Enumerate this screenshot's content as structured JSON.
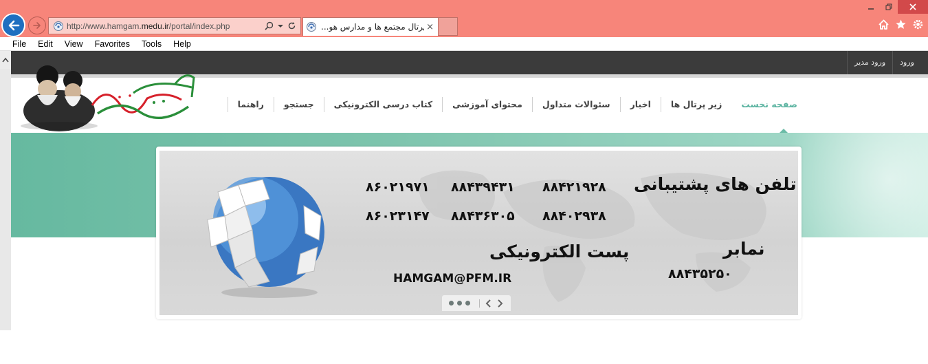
{
  "browser": {
    "url_prefix": "http://www.hamgam.",
    "url_domain": "medu.ir",
    "url_suffix": "/portal/index.php",
    "tab_title": "...پرتال مجتمع ها و مدارس هو",
    "tab_close": "×",
    "menu": [
      "File",
      "Edit",
      "View",
      "Favorites",
      "Tools",
      "Help"
    ]
  },
  "top_links": {
    "login": "ورود",
    "admin_login": "ورود مدیر"
  },
  "nav": {
    "items": [
      {
        "label": "صفحه نخست",
        "active": true
      },
      {
        "label": "زیر پرتال ها",
        "active": false
      },
      {
        "label": "اخبار",
        "active": false
      },
      {
        "label": "سئوالات متداول",
        "active": false
      },
      {
        "label": "محتوای آموزشی",
        "active": false
      },
      {
        "label": "کتاب درسی الکترونیکی",
        "active": false
      },
      {
        "label": "جستجو",
        "active": false
      },
      {
        "label": "راهنما",
        "active": false
      }
    ]
  },
  "banner": {
    "support_title": "تلفن های پشتیبانی",
    "support_numbers": [
      "۸۸۴۲۱۹۲۸",
      "۸۸۴۳۹۴۳۱",
      "۸۶۰۲۱۹۷۱",
      "۸۸۴۰۲۹۳۸",
      "۸۸۴۳۶۳۰۵",
      "۸۶۰۲۳۱۴۷"
    ],
    "fax_title": "نمابر",
    "fax_number": "۸۸۴۳۵۲۵۰",
    "email_title": "پست الکترونیکی",
    "email": "HAMGAM@PFM.IR"
  },
  "colors": {
    "titlebar": "#f7857a",
    "accent_teal": "#66b9a0",
    "active_nav": "#5ab3a0",
    "top_strip": "#3b3b3b"
  }
}
